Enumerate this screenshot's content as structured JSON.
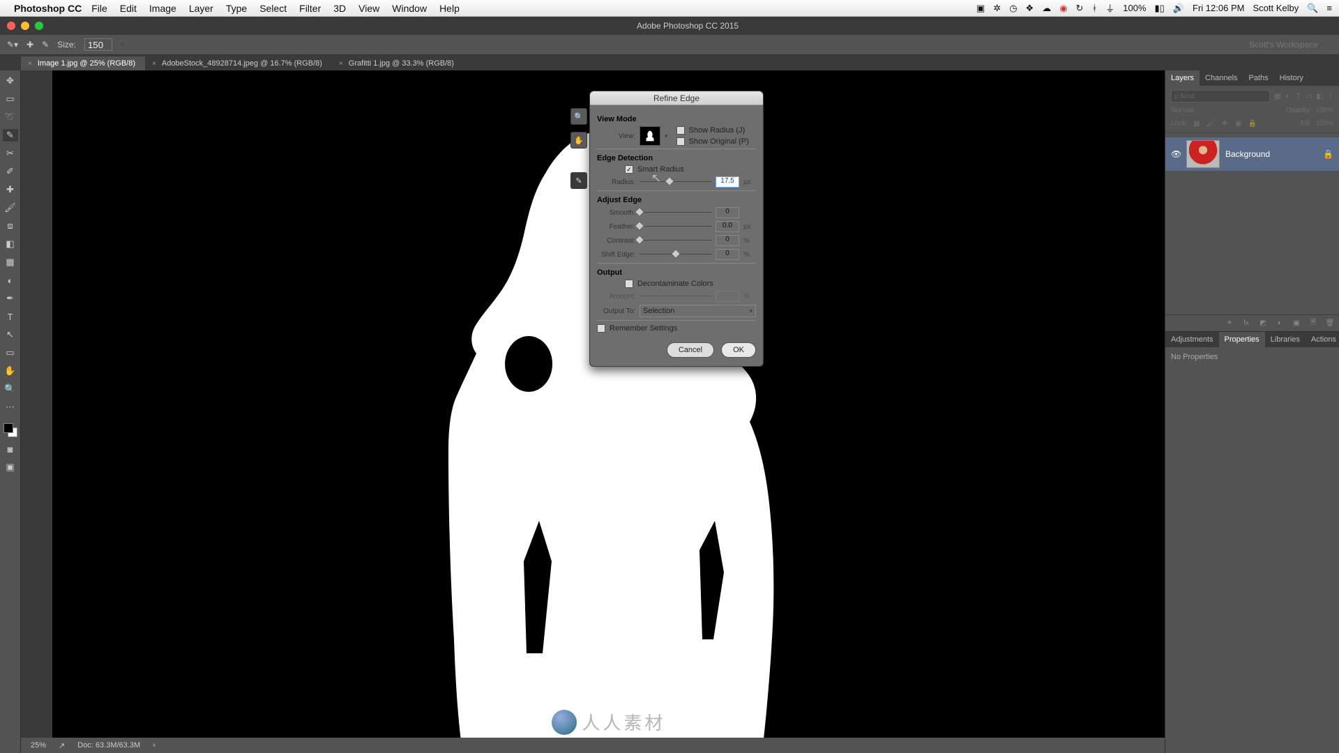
{
  "mac_menu": {
    "app_name": "Photoshop CC",
    "items": [
      "File",
      "Edit",
      "Image",
      "Layer",
      "Type",
      "Select",
      "Filter",
      "3D",
      "View",
      "Window",
      "Help"
    ],
    "right": {
      "battery": "100%",
      "time": "Fri 12:06 PM",
      "user": "Scott Kelby"
    }
  },
  "window_title": "Adobe Photoshop CC 2015",
  "options_bar": {
    "size_label": "Size:",
    "size_value": "150",
    "workspace": "Scott's Workspace"
  },
  "doc_tabs": [
    {
      "name": "Image 1.jpg @ 25% (RGB/8)",
      "active": true
    },
    {
      "name": "AdobeStock_48928714.jpeg @ 16.7% (RGB/8)",
      "active": false
    },
    {
      "name": "Grafitti 1.jpg @ 33.3% (RGB/8)",
      "active": false
    }
  ],
  "status_bar": {
    "zoom": "25%",
    "doc": "Doc: 63.3M/63.3M"
  },
  "layers_panel": {
    "tabs": [
      "Layers",
      "Channels",
      "Paths",
      "History"
    ],
    "filter_placeholder": "ρ Kind",
    "blend_mode": "Normal",
    "opacity_label": "Opacity:",
    "opacity_value": "100%",
    "lock_label": "Lock:",
    "fill_label": "Fill:",
    "fill_value": "100%",
    "layers": [
      {
        "name": "Background",
        "locked": true
      }
    ]
  },
  "prop_panel": {
    "tabs": [
      "Adjustments",
      "Properties",
      "Libraries",
      "Actions"
    ],
    "body": "No Properties"
  },
  "dialog": {
    "title": "Refine Edge",
    "view_mode": {
      "header": "View Mode",
      "view_label": "View:",
      "show_radius": "Show Radius (J)",
      "show_original": "Show Original (P)"
    },
    "edge_detection": {
      "header": "Edge Detection",
      "smart_radius": "Smart Radius",
      "smart_radius_checked": true,
      "radius_label": "Radius:",
      "radius_value": "17.5",
      "radius_unit": "px",
      "radius_pct": 42
    },
    "adjust_edge": {
      "header": "Adjust Edge",
      "rows": [
        {
          "label": "Smooth:",
          "value": "0",
          "unit": "",
          "pct": 0
        },
        {
          "label": "Feather:",
          "value": "0.0",
          "unit": "px",
          "pct": 0
        },
        {
          "label": "Contrast:",
          "value": "0",
          "unit": "%",
          "pct": 0
        },
        {
          "label": "Shift Edge:",
          "value": "0",
          "unit": "%",
          "pct": 50
        }
      ]
    },
    "output": {
      "header": "Output",
      "decontaminate": "Decontaminate Colors",
      "decontaminate_checked": false,
      "amount_label": "Amount:",
      "amount_unit": "%",
      "output_to_label": "Output To:",
      "output_to_value": "Selection"
    },
    "remember": "Remember Settings",
    "remember_checked": false,
    "cancel": "Cancel",
    "ok": "OK"
  },
  "watermark": "人人素材"
}
